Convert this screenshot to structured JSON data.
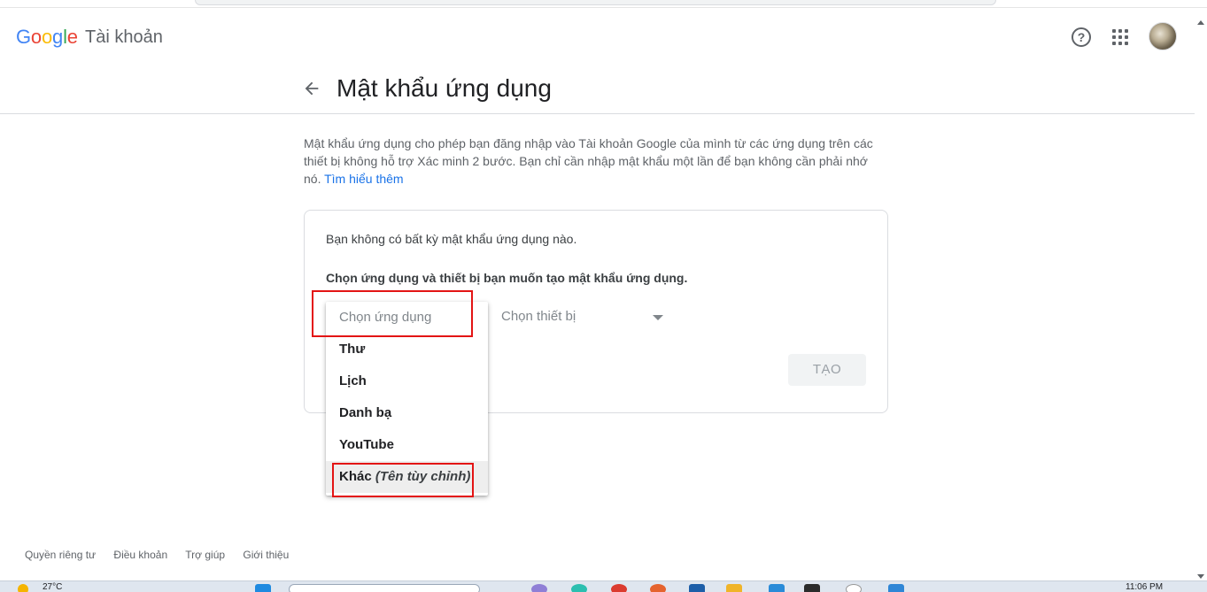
{
  "header": {
    "logo_letters": [
      {
        "ch": "G",
        "color": "#4285F4"
      },
      {
        "ch": "o",
        "color": "#EA4335"
      },
      {
        "ch": "o",
        "color": "#FBBC05"
      },
      {
        "ch": "g",
        "color": "#4285F4"
      },
      {
        "ch": "l",
        "color": "#34A853"
      },
      {
        "ch": "e",
        "color": "#EA4335"
      }
    ],
    "product": "Tài khoản",
    "help_symbol": "?"
  },
  "page": {
    "title": "Mật khẩu ứng dụng",
    "intro": "Mật khẩu ứng dụng cho phép bạn đăng nhập vào Tài khoản Google của mình từ các ứng dụng trên các thiết bị không hỗ trợ Xác minh 2 bước. Bạn chỉ cần nhập mật khẩu một lần để bạn không cần phải nhớ nó.",
    "learn_more": "Tìm hiểu thêm"
  },
  "card": {
    "no_passwords": "Bạn không có bất kỳ mật khẩu ứng dụng nào.",
    "choose_text": "Chọn ứng dụng và thiết bị bạn muốn tạo mật khẩu ứng dụng.",
    "device_select": "Chọn thiết bị",
    "create_button": "TẠO"
  },
  "menu": {
    "placeholder": "Chọn ứng dụng",
    "items": [
      "Thư",
      "Lịch",
      "Danh bạ",
      "YouTube"
    ],
    "other_label": "Khác",
    "other_custom": "(Tên tùy chỉnh)"
  },
  "footer": {
    "links": [
      "Quyền riêng tư",
      "Điều khoản",
      "Trợ giúp",
      "Giới thiệu"
    ]
  },
  "taskbar": {
    "weather": "27°C",
    "clock": "11:06 PM"
  },
  "colors": {
    "highlight": "#e31414",
    "link": "#1a73e8"
  }
}
